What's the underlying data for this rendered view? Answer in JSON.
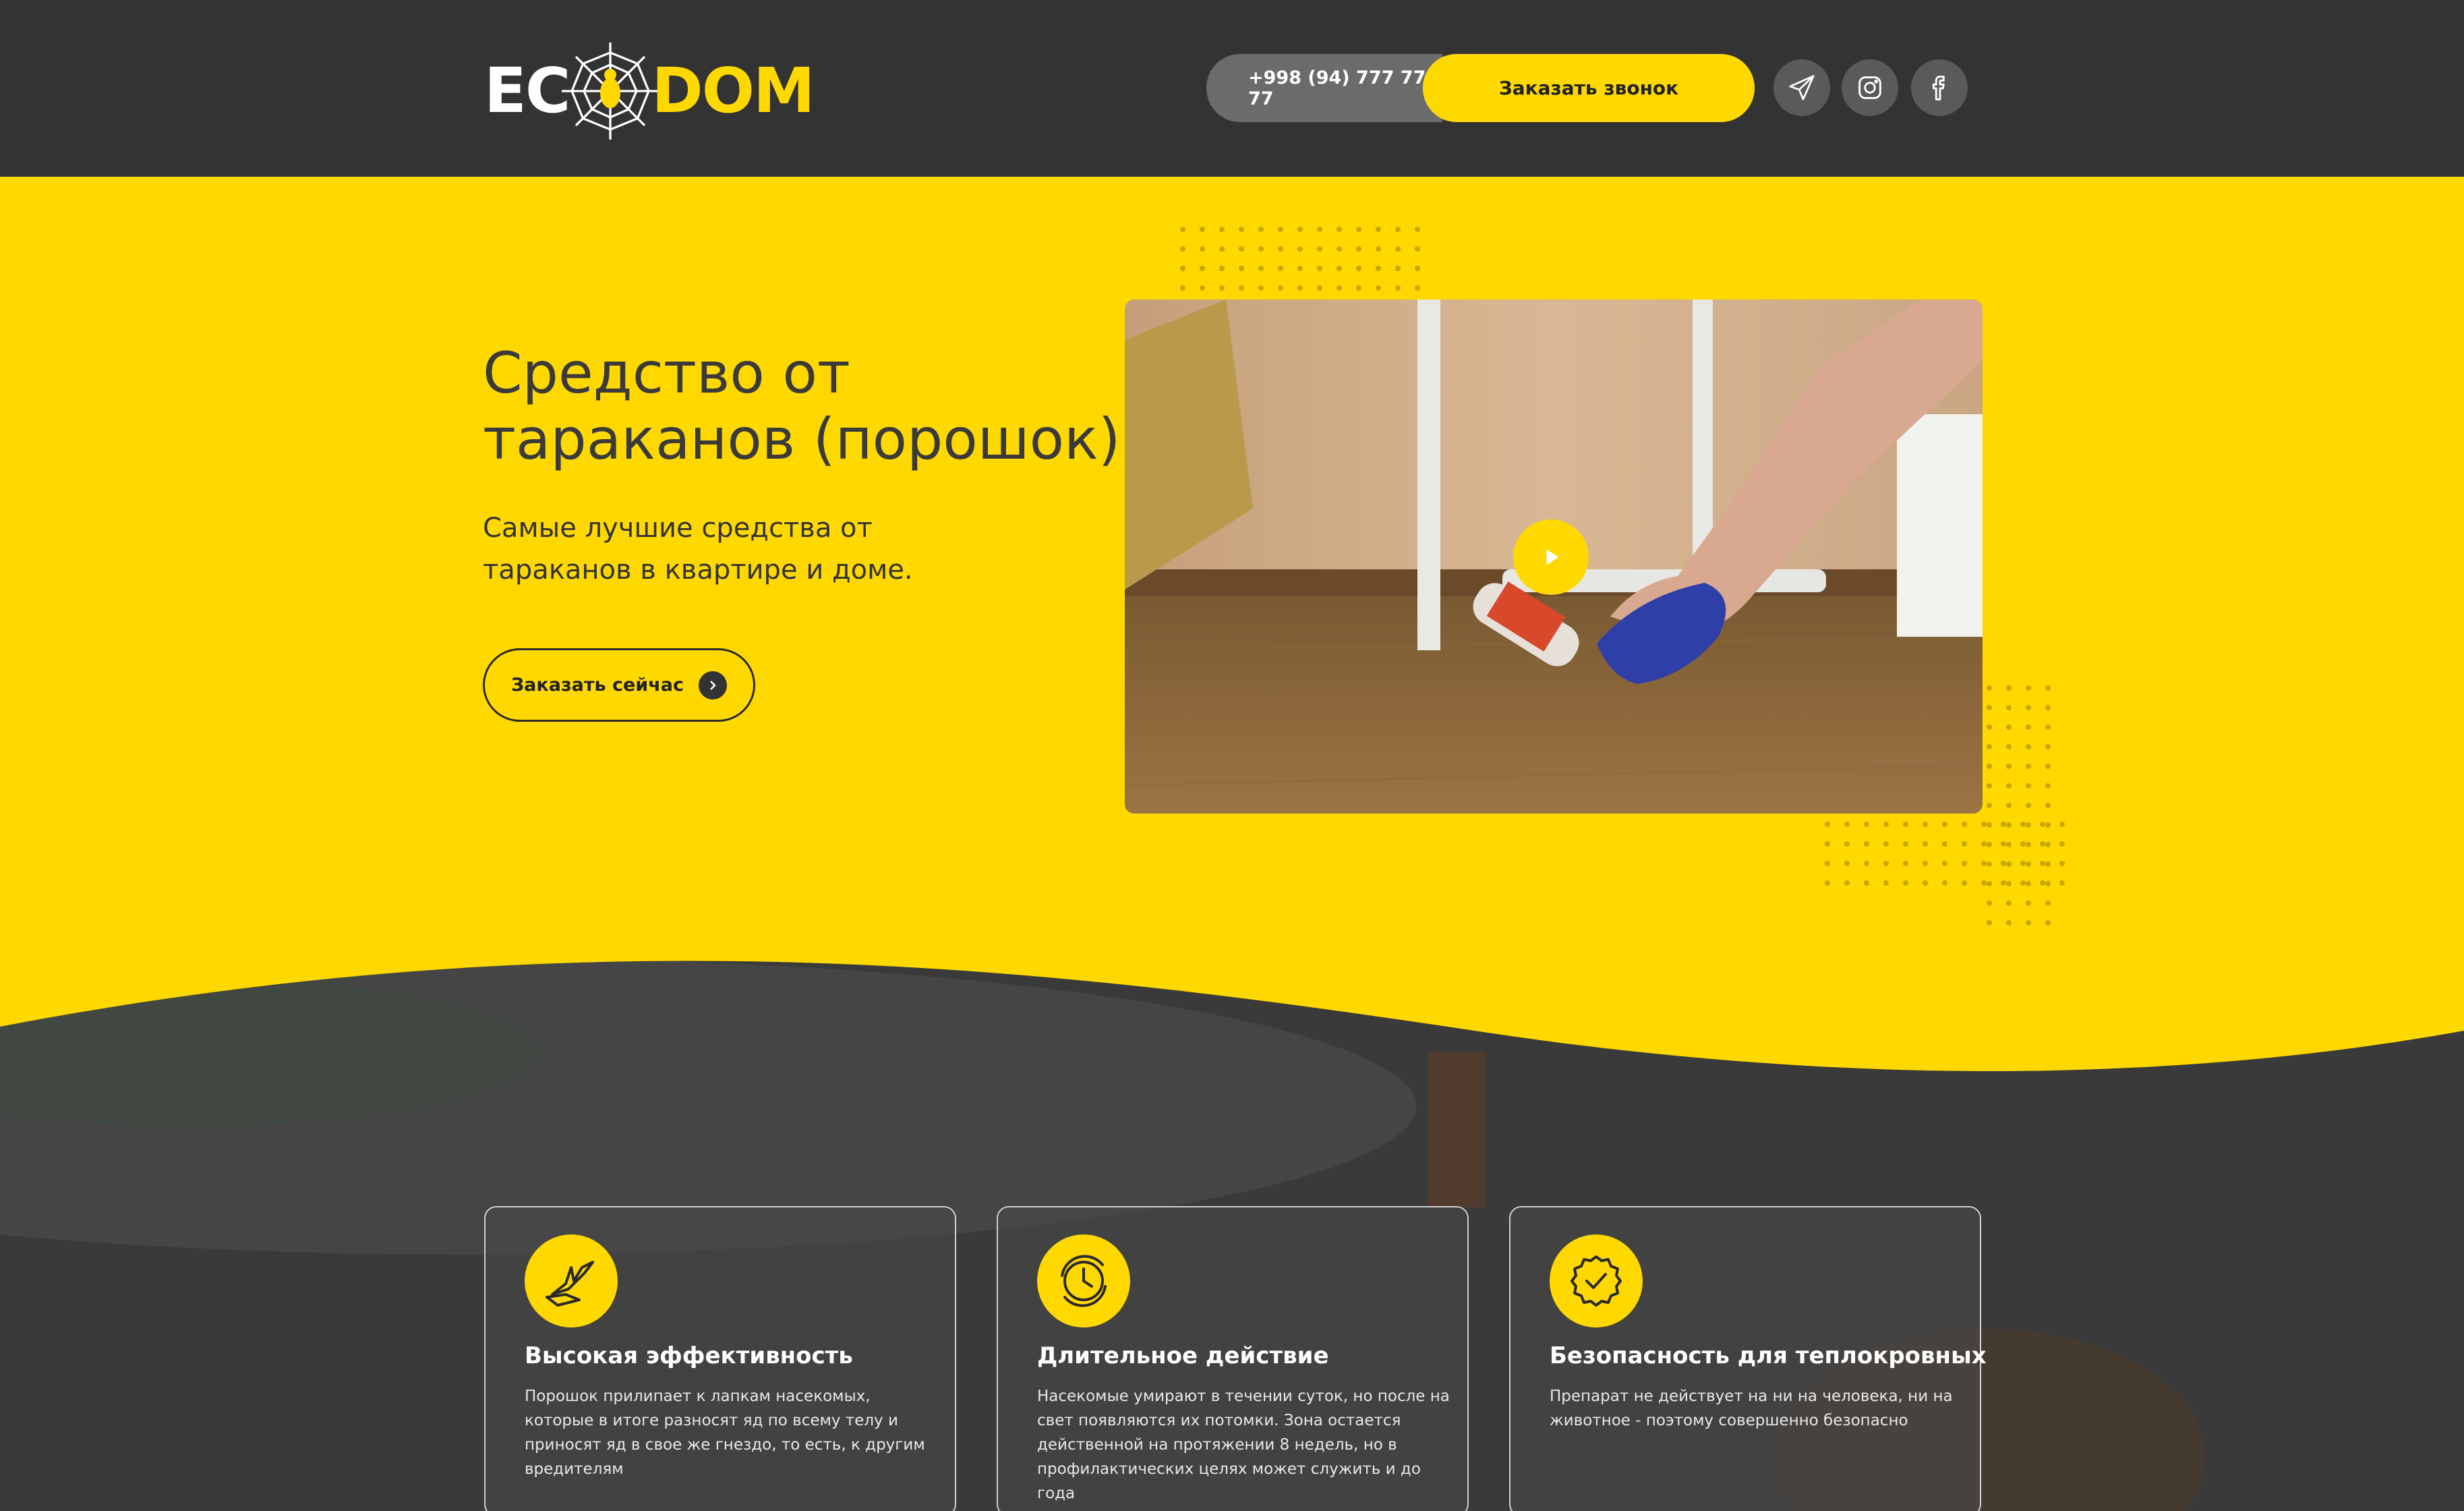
{
  "header": {
    "logo_left": "EC",
    "logo_right": "DOM",
    "phone": "+998 (94) 777 77 77",
    "callback_label": "Заказать звонок",
    "socials": [
      "telegram-icon",
      "instagram-icon",
      "facebook-icon"
    ]
  },
  "hero": {
    "title": "Средство от тараканов (порошок)",
    "subtitle": "Самые лучшие средства от тараканов в квартире и доме.",
    "order_label": "Заказать сейчас",
    "video_icon": "play-icon"
  },
  "colors": {
    "accent": "#ffd800",
    "header_bg": "#333333",
    "dark_bg": "#3a3a3a"
  },
  "features": [
    {
      "icon": "bird-hand-icon",
      "title": "Высокая эффективность",
      "text": "Порошок прилипает к лапкам насекомых, которые в итоге разносят яд по всему телу и приносят яд в свое же гнездо, то есть, к другим вредителям"
    },
    {
      "icon": "clock-icon",
      "title": "Длительное действие",
      "text": "Насекомые умирают в течении суток, но после на свет появляются их потомки. Зона остается действенной на протяжении 8 недель, но в профилактических целях может служить и до года"
    },
    {
      "icon": "badge-check-icon",
      "title": "Безопасность для теплокровных",
      "text": "Препарат не действует на ни на человека, ни на животное - поэтому совершенно безопасно"
    }
  ]
}
